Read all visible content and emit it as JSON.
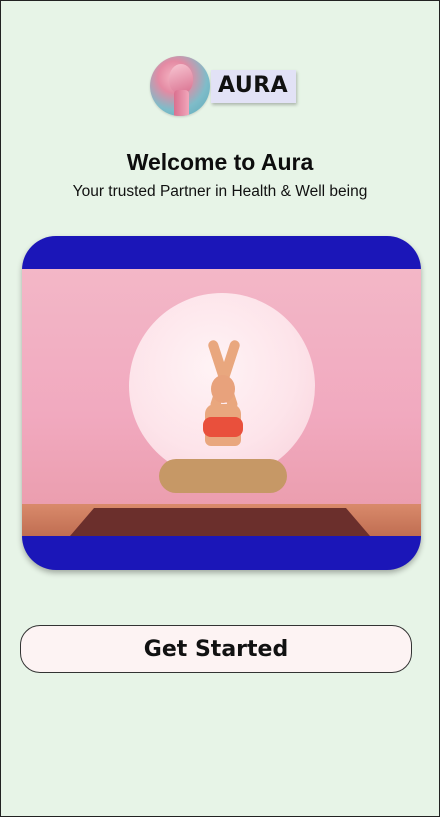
{
  "brand": {
    "name": "AURA",
    "logo_icon": "mannequin-head-icon"
  },
  "welcome": {
    "title": "Welcome to Aura",
    "subtitle": "Your trusted Partner in Health & Well being"
  },
  "hero": {
    "image_icon": "yoga-meditation-image",
    "frame_color": "#1b16b8"
  },
  "actions": {
    "get_started_label": "Get Started"
  },
  "colors": {
    "background": "#e7f4e7",
    "button_bg": "#fdf3f3"
  }
}
